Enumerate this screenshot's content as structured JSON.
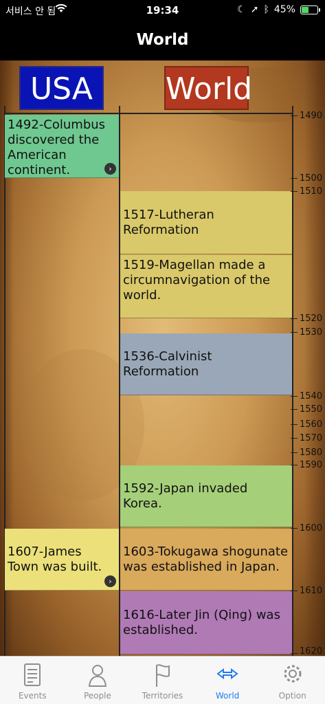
{
  "status_bar": {
    "carrier": "서비스 안 됨",
    "time": "19:34",
    "battery_percent": "45%",
    "battery_level": 0.45
  },
  "nav": {
    "title": "World"
  },
  "columns": {
    "usa": "USA",
    "world": "World"
  },
  "ticks": [
    "1490",
    "1500",
    "1510",
    "1520",
    "1530",
    "1540",
    "1550",
    "1560",
    "1570",
    "1580",
    "1590",
    "1600",
    "1610",
    "1620"
  ],
  "usa_events": [
    {
      "label": "1492-Columbus discovered the American continent.",
      "color": "#6fc890"
    },
    {
      "label": "1607-James Town was built.",
      "color": "#ebe07a"
    }
  ],
  "world_events": [
    {
      "label": "1517-Lutheran Reformation",
      "color": "#d9c96a"
    },
    {
      "label": "1519-Magellan made a circumnavigation of the world.",
      "color": "#d9c96a"
    },
    {
      "label": "1536-Calvinist Reformation",
      "color": "#9aa7b8"
    },
    {
      "label": "1592-Japan invaded Korea.",
      "color": "#a6cf7a"
    },
    {
      "label": "1603-Tokugawa shogunate was established in Japan.",
      "color": "#d9a95c"
    },
    {
      "label": "1616-Later Jin (Qing) was established.",
      "color": "#b07ab5"
    }
  ],
  "tabs": [
    {
      "label": "Events",
      "icon": "document-icon"
    },
    {
      "label": "People",
      "icon": "person-icon"
    },
    {
      "label": "Territories",
      "icon": "flag-icon"
    },
    {
      "label": "World",
      "icon": "world-arrows-icon",
      "active": true
    },
    {
      "label": "Option",
      "icon": "gear-icon"
    }
  ]
}
